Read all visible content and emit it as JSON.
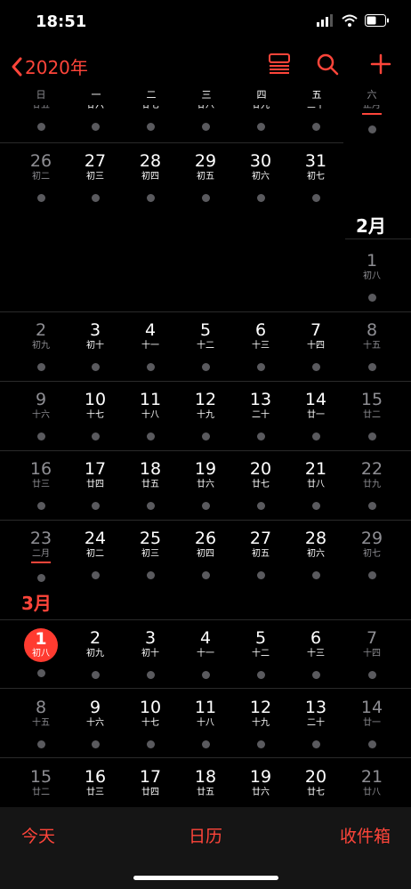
{
  "status": {
    "time": "18:51"
  },
  "nav": {
    "back_label": "2020年"
  },
  "weekdays": [
    "日",
    "一",
    "二",
    "三",
    "四",
    "五",
    "六"
  ],
  "months": {
    "feb": "2月",
    "mar": "3月"
  },
  "weeks": [
    {
      "cells": [
        {
          "d": "",
          "l": "廿五",
          "dim": true
        },
        {
          "d": "",
          "l": "廿六"
        },
        {
          "d": "",
          "l": "廿七"
        },
        {
          "d": "",
          "l": "廿八"
        },
        {
          "d": "",
          "l": "廿九"
        },
        {
          "d": "",
          "l": "三十"
        },
        {
          "d": "",
          "l": "正月",
          "dim": true,
          "under": true
        }
      ]
    },
    {
      "cells": [
        {
          "d": "26",
          "l": "初二",
          "dim": true
        },
        {
          "d": "27",
          "l": "初三"
        },
        {
          "d": "28",
          "l": "初四"
        },
        {
          "d": "29",
          "l": "初五"
        },
        {
          "d": "30",
          "l": "初六"
        },
        {
          "d": "31",
          "l": "初七"
        }
      ]
    },
    {
      "cells": [
        {
          "d": "1",
          "l": "初八",
          "dim": true
        }
      ]
    },
    {
      "cells": [
        {
          "d": "2",
          "l": "初九",
          "dim": true
        },
        {
          "d": "3",
          "l": "初十"
        },
        {
          "d": "4",
          "l": "十一"
        },
        {
          "d": "5",
          "l": "十二"
        },
        {
          "d": "6",
          "l": "十三"
        },
        {
          "d": "7",
          "l": "十四"
        },
        {
          "d": "8",
          "l": "十五",
          "dim": true
        }
      ]
    },
    {
      "cells": [
        {
          "d": "9",
          "l": "十六",
          "dim": true
        },
        {
          "d": "10",
          "l": "十七"
        },
        {
          "d": "11",
          "l": "十八"
        },
        {
          "d": "12",
          "l": "十九"
        },
        {
          "d": "13",
          "l": "二十"
        },
        {
          "d": "14",
          "l": "廿一"
        },
        {
          "d": "15",
          "l": "廿二",
          "dim": true
        }
      ]
    },
    {
      "cells": [
        {
          "d": "16",
          "l": "廿三",
          "dim": true
        },
        {
          "d": "17",
          "l": "廿四"
        },
        {
          "d": "18",
          "l": "廿五"
        },
        {
          "d": "19",
          "l": "廿六"
        },
        {
          "d": "20",
          "l": "廿七"
        },
        {
          "d": "21",
          "l": "廿八"
        },
        {
          "d": "22",
          "l": "廿九",
          "dim": true
        }
      ]
    },
    {
      "cells": [
        {
          "d": "23",
          "l": "二月",
          "dim": true,
          "under": true
        },
        {
          "d": "24",
          "l": "初二"
        },
        {
          "d": "25",
          "l": "初三"
        },
        {
          "d": "26",
          "l": "初四"
        },
        {
          "d": "27",
          "l": "初五"
        },
        {
          "d": "28",
          "l": "初六"
        },
        {
          "d": "29",
          "l": "初七",
          "dim": true
        }
      ]
    },
    {
      "cells": [
        {
          "d": "1",
          "l": "初八",
          "today": true
        },
        {
          "d": "2",
          "l": "初九"
        },
        {
          "d": "3",
          "l": "初十"
        },
        {
          "d": "4",
          "l": "十一"
        },
        {
          "d": "5",
          "l": "十二"
        },
        {
          "d": "6",
          "l": "十三"
        },
        {
          "d": "7",
          "l": "十四",
          "dim": true
        }
      ]
    },
    {
      "cells": [
        {
          "d": "8",
          "l": "十五",
          "dim": true
        },
        {
          "d": "9",
          "l": "十六"
        },
        {
          "d": "10",
          "l": "十七"
        },
        {
          "d": "11",
          "l": "十八"
        },
        {
          "d": "12",
          "l": "十九"
        },
        {
          "d": "13",
          "l": "二十"
        },
        {
          "d": "14",
          "l": "廿一",
          "dim": true
        }
      ]
    },
    {
      "cells": [
        {
          "d": "15",
          "l": "廿二",
          "dim": true
        },
        {
          "d": "16",
          "l": "廿三"
        },
        {
          "d": "17",
          "l": "廿四"
        },
        {
          "d": "18",
          "l": "廿五"
        },
        {
          "d": "19",
          "l": "廿六"
        },
        {
          "d": "20",
          "l": "廿七"
        },
        {
          "d": "21",
          "l": "廿八",
          "dim": true
        }
      ]
    }
  ],
  "toolbar": {
    "today": "今天",
    "calendars": "日历",
    "inbox": "收件箱"
  },
  "colors": {
    "accent": "#ff453a",
    "today_bg": "#ff3b30"
  }
}
